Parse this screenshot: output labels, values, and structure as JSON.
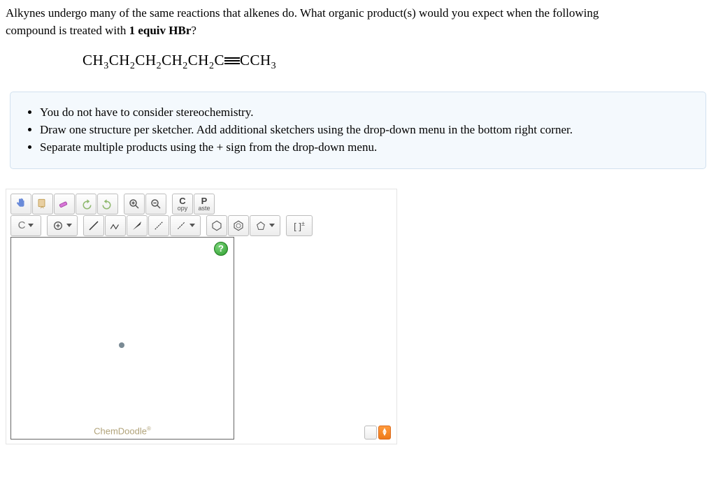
{
  "question": {
    "line1": "Alkynes undergo many of the same reactions that alkenes do. What organic product(s) would you expect when the following",
    "line2_prefix": "compound is treated with ",
    "line2_bold": "1 equiv HBr",
    "line2_suffix": "?"
  },
  "formula_parts": {
    "p1": "CH",
    "s1": "3",
    "p2": "CH",
    "s2": "2",
    "p3": "CH",
    "s3": "2",
    "p4": "CH",
    "s4": "2",
    "p5": "CH",
    "s5": "2",
    "p6": "C",
    "p7": "CCH",
    "s7": "3"
  },
  "hints": [
    "You do not have to consider stereochemistry.",
    "Draw one structure per sketcher. Add additional sketchers using the drop-down menu in the bottom right corner.",
    "Separate multiple products using the + sign from the drop-down menu."
  ],
  "toolbar": {
    "copy_top": "C",
    "copy_bottom": "opy",
    "paste_top": "P",
    "paste_bottom": "aste",
    "element": "C",
    "bracket": "[ ]",
    "charge_sup": "±"
  },
  "icons": {
    "hand": "hand-icon",
    "lasso": "lasso-icon",
    "erase": "erase-icon",
    "undo": "undo-icon",
    "redo": "redo-icon",
    "zoomin": "zoom-in-icon",
    "zoomout": "zoom-out-icon",
    "plus": "plus-circle-icon",
    "single": "single-bond-icon",
    "chain": "chain-icon",
    "wedge": "wedge-up-icon",
    "hash": "wedge-down-icon",
    "wavy": "wavy-bond-icon",
    "hexagon": "hexagon-icon",
    "benzene": "benzene-icon",
    "pentagon": "pentagon-icon"
  },
  "canvas": {
    "help": "?",
    "brand": "ChemDoodle"
  }
}
